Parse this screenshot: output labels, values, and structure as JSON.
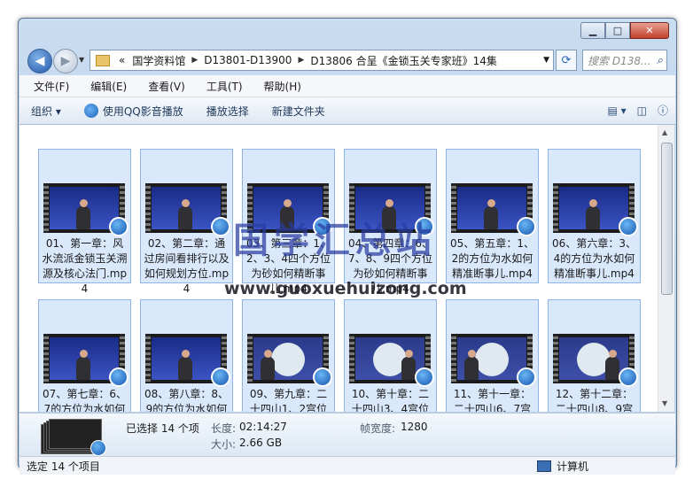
{
  "window": {
    "caption_buttons": [
      "minimize",
      "maximize",
      "close"
    ]
  },
  "address": {
    "prefix": "«",
    "segments": [
      "国学资料馆",
      "D13801-D13900",
      "D13806 合呈《金锁玉关专家班》14集"
    ],
    "search_placeholder": "搜索 D138..."
  },
  "menu": [
    "文件(F)",
    "编辑(E)",
    "查看(V)",
    "工具(T)",
    "帮助(H)"
  ],
  "toolbar": {
    "organize": "组织 ▾",
    "play_qq": "使用QQ影音播放",
    "play_select": "播放选择",
    "new_folder": "新建文件夹"
  },
  "files": [
    {
      "label": "01、第一章：风水流派金锁玉关溯源及核心法门.mp4",
      "scene": "dark"
    },
    {
      "label": "02、第二章：通过房间看排行以及如何规划方位.mp4",
      "scene": "dark"
    },
    {
      "label": "03、第三章：1、2、3、4四个方位为砂如何精断事儿.mp4",
      "scene": "dark"
    },
    {
      "label": "04、第四章：6、7、8、9四个方位为砂如何精断事儿.mp4",
      "scene": "dark"
    },
    {
      "label": "05、第五章：1、2的方位为水如何精准断事儿.mp4",
      "scene": "dark"
    },
    {
      "label": "06、第六章：3、4的方位为水如何精准断事儿.mp4",
      "scene": "dark"
    },
    {
      "label": "07、第七章：6、7的方位为水如何",
      "scene": "dark"
    },
    {
      "label": "08、第八章：8、9的方位为水如何",
      "scene": "dark"
    },
    {
      "label": "09、第九章：二十四山1、2宫位",
      "scene": "light"
    },
    {
      "label": "10、第十章：二十四山3、4宫位",
      "scene": "light"
    },
    {
      "label": "11、第十一章：二十四山6、7宫",
      "scene": "light"
    },
    {
      "label": "12、第十二章：二十四山8、9宫",
      "scene": "light"
    }
  ],
  "details": {
    "selected": "已选择 14 个项",
    "length_label": "长度:",
    "length_value": "02:14:27",
    "size_label": "大小:",
    "size_value": "2.66 GB",
    "frame_width_label": "帧宽度:",
    "frame_width_value": "1280"
  },
  "status": {
    "left": "选定 14 个项目",
    "right": "计算机"
  },
  "watermark": {
    "title": "国学汇总站",
    "url": "www.guoxuehuizong.com"
  }
}
